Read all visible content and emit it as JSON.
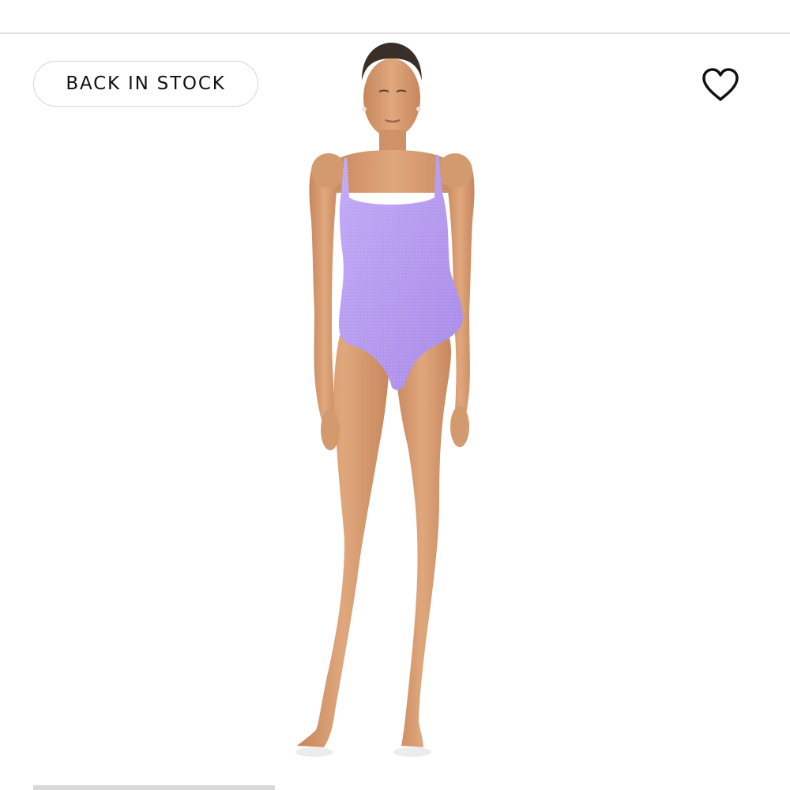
{
  "badge": {
    "label": "BACK IN STOCK"
  },
  "wishlist": {
    "icon": "heart-outline-icon"
  },
  "product": {
    "image": "model-wearing-lavender-one-piece-swimsuit",
    "swimsuit_color": "#b79cf0",
    "skin_color": "#d99c72"
  },
  "colors": {
    "divider": "#e2e2e2",
    "badge_border": "#d6d6d6",
    "text": "#111111"
  }
}
